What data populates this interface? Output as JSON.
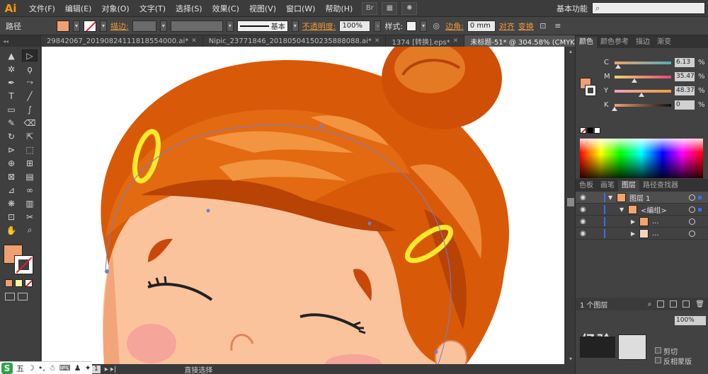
{
  "app": {
    "logo": "Ai"
  },
  "menubar": {
    "items": [
      "文件(F)",
      "编辑(E)",
      "对象(O)",
      "文字(T)",
      "选择(S)",
      "效果(C)",
      "视图(V)",
      "窗口(W)",
      "帮助(H)"
    ],
    "workspace": "基本功能",
    "search_placeholder": ""
  },
  "controlbar": {
    "object_type": "路径",
    "fill_color": "#f0a070",
    "stroke_label": "描边:",
    "brush_label": "基本",
    "opacity_label": "不透明度:",
    "opacity_value": "100%",
    "style_label": "样式:",
    "corner_label": "边角:",
    "corner_value": "0 mm",
    "align_label": "对齐",
    "transform_label": "变换"
  },
  "tabs": [
    {
      "label": "29842067_20190824111818554000.ai*",
      "active": false
    },
    {
      "label": "Nipic_23771846_20180504150235888088.ai*",
      "active": false
    },
    {
      "label": "1374 [转换].eps*",
      "active": false
    },
    {
      "label": "未标题-51* @ 304.58% (CMYK/预览)",
      "active": true
    }
  ],
  "tools": {
    "icons": [
      "selection-tool-icon",
      "direct-selection-tool-icon",
      "magic-wand-icon",
      "lasso-icon",
      "pen-tool-icon",
      "curvature-icon",
      "type-tool-icon",
      "line-tool-icon",
      "rectangle-tool-icon",
      "paintbrush-icon",
      "pencil-icon",
      "eraser-icon",
      "rotate-icon",
      "scale-icon",
      "width-tool-icon",
      "free-transform-icon",
      "shape-builder-icon",
      "perspective-icon",
      "mesh-icon",
      "gradient-icon",
      "eyedropper-icon",
      "blend-icon",
      "symbol-sprayer-icon",
      "graph-icon",
      "artboard-icon",
      "slice-icon",
      "hand-icon",
      "zoom-icon"
    ],
    "glyphs": [
      "▲",
      "▷",
      "✲",
      "ϙ",
      "✒",
      "⤳",
      "T",
      "╱",
      "▭",
      "∫",
      "✎",
      "⌫",
      "↻",
      "⇱",
      "⊳",
      "⬚",
      "⊕",
      "⊞",
      "⊠",
      "▤",
      "⊿",
      "∞",
      "❋",
      "▥",
      "⊡",
      "✂",
      "✋",
      "⌕"
    ],
    "fill_color": "#f0a070"
  },
  "status": {
    "zoom": "",
    "page": "1",
    "tool_name": "直接选择"
  },
  "ime": {
    "logo": "S",
    "mode": "五"
  },
  "color_panel": {
    "tabs": [
      "颜色",
      "颜色参考",
      "描边",
      "渐变"
    ],
    "active_tab": "颜色",
    "channels": [
      {
        "letter": "C",
        "value": "6.13",
        "fraction": 0.06
      },
      {
        "letter": "M",
        "value": "35.47",
        "fraction": 0.35
      },
      {
        "letter": "Y",
        "value": "48.37",
        "fraction": 0.48
      },
      {
        "letter": "K",
        "value": "0",
        "fraction": 0.0
      }
    ],
    "pct": "%",
    "swatch_color": "#f0a070"
  },
  "layers_panel": {
    "tabs": [
      "色板",
      "画笔",
      "图层",
      "路径查找器"
    ],
    "active_tab": "图层",
    "rows": [
      {
        "name": "图层 1",
        "level": 0,
        "expanded": true
      },
      {
        "name": "<编组>",
        "level": 1,
        "expanded": true
      },
      {
        "name": "...",
        "level": 2,
        "expanded": false
      },
      {
        "name": "...",
        "level": 2,
        "expanded": false
      }
    ],
    "footer": "1 个图层"
  },
  "transparency_panel": {
    "opacity_value": "100%",
    "clip_label": "剪切",
    "invert_label": "反相蒙版",
    "watermark": "经验"
  }
}
